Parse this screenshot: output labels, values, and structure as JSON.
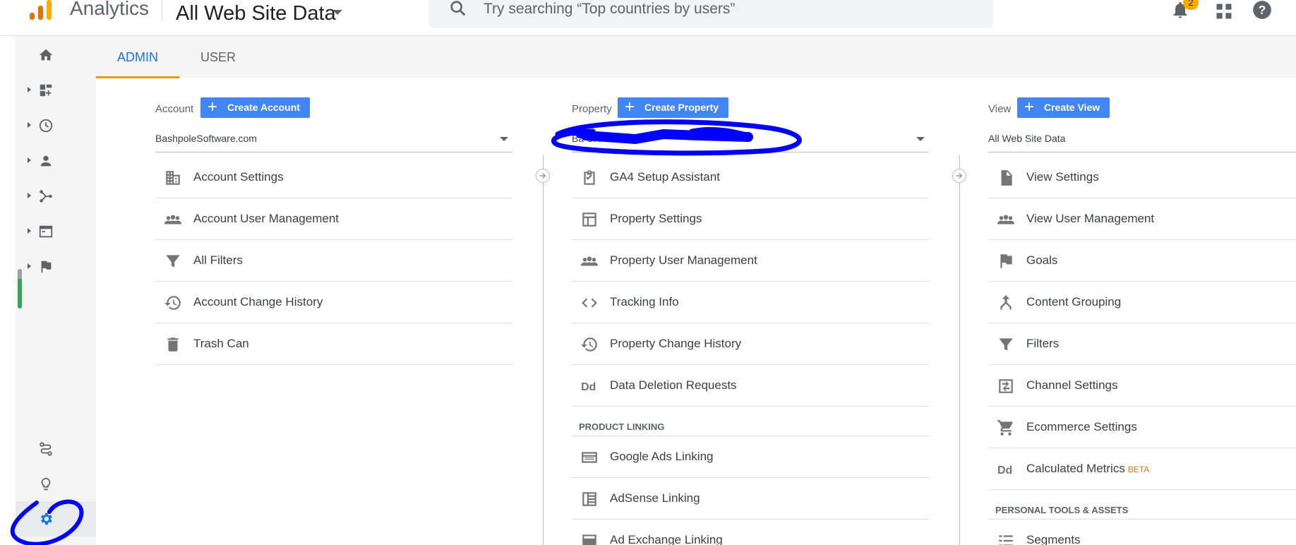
{
  "header": {
    "brand": "Analytics",
    "account_view": "All Web Site Data",
    "search_placeholder": "Try searching “Top countries by users”",
    "notification_count": "2"
  },
  "tabs": [
    {
      "label": "ADMIN",
      "active": true
    },
    {
      "label": "USER",
      "active": false
    }
  ],
  "account": {
    "label": "Account",
    "create_label": "Create Account",
    "selected": "BashpoleSoftware.com",
    "items": [
      {
        "label": "Account Settings",
        "icon": "building-icon"
      },
      {
        "label": "Account User Management",
        "icon": "people-icon"
      },
      {
        "label": "All Filters",
        "icon": "filter-icon"
      },
      {
        "label": "Account Change History",
        "icon": "history-icon"
      },
      {
        "label": "Trash Can",
        "icon": "trash-icon"
      }
    ]
  },
  "property": {
    "label": "Property",
    "create_label": "Create Property",
    "selected": "Ba                    UA-",
    "items": [
      {
        "label": "GA4 Setup Assistant",
        "icon": "checklist-icon"
      },
      {
        "label": "Property Settings",
        "icon": "layout-icon"
      },
      {
        "label": "Property User Management",
        "icon": "people-icon"
      },
      {
        "label": "Tracking Info",
        "icon": "code-icon"
      },
      {
        "label": "Property Change History",
        "icon": "history-icon"
      },
      {
        "label": "Data Deletion Requests",
        "icon": "dd-icon"
      }
    ],
    "section": "PRODUCT LINKING",
    "section_items": [
      {
        "label": "Google Ads Linking",
        "icon": "ads-icon"
      },
      {
        "label": "AdSense Linking",
        "icon": "adsense-icon"
      },
      {
        "label": "Ad Exchange Linking",
        "icon": "adexchange-icon"
      }
    ]
  },
  "view": {
    "label": "View",
    "create_label": "Create View",
    "selected": "All Web Site Data",
    "items": [
      {
        "label": "View Settings",
        "icon": "document-icon"
      },
      {
        "label": "View User Management",
        "icon": "people-icon"
      },
      {
        "label": "Goals",
        "icon": "flag-icon"
      },
      {
        "label": "Content Grouping",
        "icon": "merge-icon"
      },
      {
        "label": "Filters",
        "icon": "filter-icon"
      },
      {
        "label": "Channel Settings",
        "icon": "channel-icon"
      },
      {
        "label": "Ecommerce Settings",
        "icon": "cart-icon"
      },
      {
        "label": "Calculated Metrics",
        "icon": "dd-icon",
        "badge": "BETA"
      }
    ],
    "section": "PERSONAL TOOLS & ASSETS",
    "section_items": [
      {
        "label": "Segments",
        "icon": "segments-icon"
      }
    ]
  },
  "colors": {
    "accent": "#1a73e8",
    "button": "#4285f4",
    "tab_underline": "#f29900",
    "annotation": "#0000ff"
  }
}
